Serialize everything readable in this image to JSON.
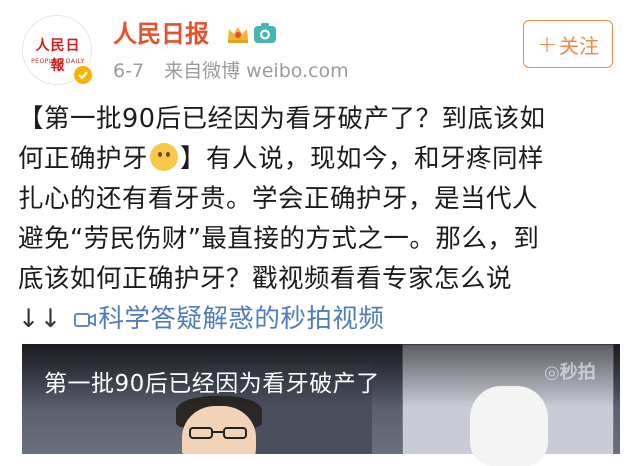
{
  "account": {
    "avatar_text": "人民日報",
    "avatar_subtext": "PEOPLE'S DAILY",
    "name": "人民日报",
    "date": "6-7",
    "source": "来自微博 weibo.com",
    "follow_label": "关注"
  },
  "post": {
    "lines": [
      "【第一批90后已经因为看牙破产了？到底该如",
      "何正确护牙",
      "】有人说，现如今，和牙疼同样",
      "扎心的还有看牙贵。学会正确护牙，是当代人",
      "避免“劳民伤财”最直接的方式之一。那么，到",
      "底该如何正确护牙？戳视频看看专家怎么说",
      "↓↓",
      "科学答疑解惑的秒拍视频"
    ]
  },
  "video": {
    "title": "第一批90后已经因为看牙破产了",
    "watermark": "秒拍"
  },
  "colors": {
    "brand": "#e8502b",
    "follow": "#f08a47",
    "link": "#4f7cbb",
    "meta": "#9b9b9b"
  }
}
